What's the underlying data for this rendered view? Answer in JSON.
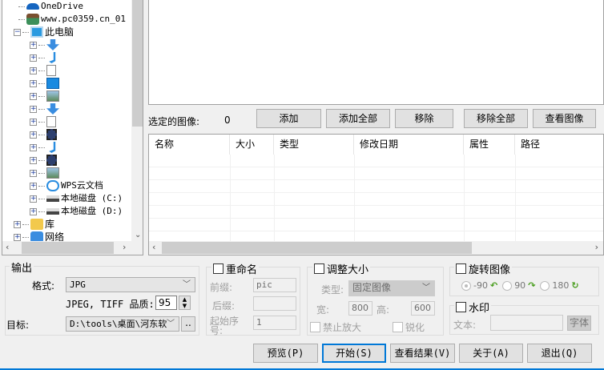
{
  "tree": {
    "items": [
      {
        "label": "OneDrive",
        "icon": "onedrive-icon"
      },
      {
        "label": "www.pc0359.cn_01",
        "icon": "user-icon"
      },
      {
        "label": "此电脑",
        "icon": "computer-icon",
        "expanded": true
      },
      {
        "label": "",
        "icon": "downloads-icon"
      },
      {
        "label": "",
        "icon": "music-icon"
      },
      {
        "label": "",
        "icon": "document-icon"
      },
      {
        "label": "",
        "icon": "desktop-icon"
      },
      {
        "label": "",
        "icon": "pictures-icon"
      },
      {
        "label": "",
        "icon": "downloads-icon"
      },
      {
        "label": "",
        "icon": "document-icon"
      },
      {
        "label": "",
        "icon": "video-icon"
      },
      {
        "label": "",
        "icon": "music-icon"
      },
      {
        "label": "",
        "icon": "video-icon"
      },
      {
        "label": "",
        "icon": "pictures-icon"
      },
      {
        "label": "WPS云文档",
        "icon": "cloud-icon"
      },
      {
        "label": "本地磁盘 (C:)",
        "icon": "drive-icon"
      },
      {
        "label": "本地磁盘 (D:)",
        "icon": "drive-icon"
      },
      {
        "label": "库",
        "icon": "library-icon"
      },
      {
        "label": "网络",
        "icon": "network-icon"
      }
    ]
  },
  "selected": {
    "label": "选定的图像:",
    "count": "0"
  },
  "actions": {
    "add": "添加",
    "add_all": "添加全部",
    "remove": "移除",
    "remove_all": "移除全部",
    "view": "查看图像"
  },
  "list": {
    "columns": [
      "名称",
      "大小",
      "类型",
      "修改日期",
      "属性",
      "路径"
    ],
    "rows": []
  },
  "output": {
    "title": "输出",
    "format_label": "格式:",
    "format_value": "JPG",
    "quality_label": "JPEG, TIFF 品质:",
    "quality_value": "95",
    "target_label": "目标:",
    "target_value": "D:\\tools\\桌面\\河东软",
    "browse": ".."
  },
  "rename": {
    "title": "重命名",
    "checked": false,
    "prefix_label": "前缀:",
    "prefix_value": "pic",
    "suffix_label": "后缀:",
    "suffix_value": "",
    "start_label": "起始序号:",
    "start_value": "1"
  },
  "resize": {
    "title": "调整大小",
    "checked": false,
    "type_label": "类型:",
    "type_value": "固定图像",
    "width_label": "宽:",
    "width_value": "800",
    "height_label": "高:",
    "height_value": "600",
    "no_enlarge": "禁止放大",
    "sharpen": "锐化"
  },
  "rotate": {
    "title": "旋转图像",
    "checked": false,
    "options": [
      "-90",
      "90",
      "180"
    ],
    "selected": "-90"
  },
  "watermark": {
    "title": "水印",
    "checked": false,
    "text_label": "文本:",
    "text_value": "",
    "font_button": "字体"
  },
  "footer": {
    "preview": "预览(P)",
    "start": "开始(S)",
    "view_result": "查看结果(V)",
    "about": "关于(A)",
    "exit": "退出(Q)"
  },
  "colors": {
    "accent": "#0078d7",
    "panel": "#f0f0f0"
  }
}
